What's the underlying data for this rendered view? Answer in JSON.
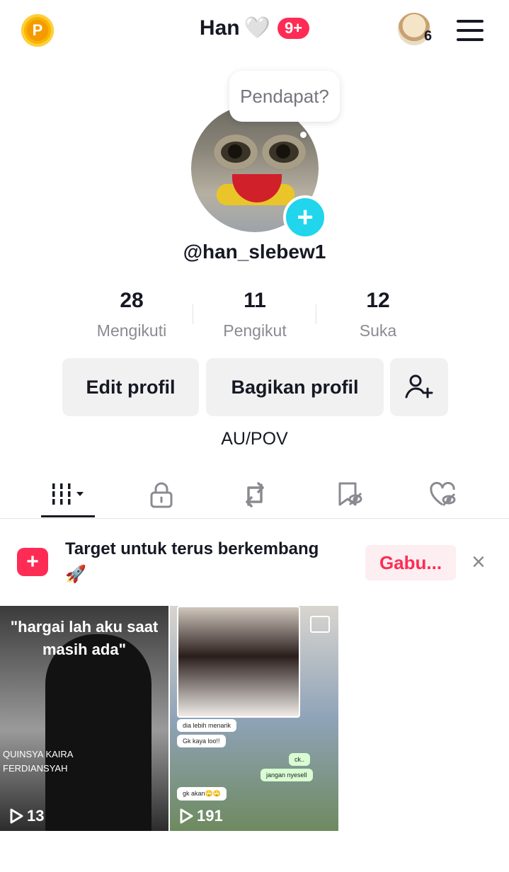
{
  "header": {
    "coin_label": "P",
    "name": "Han",
    "heart_glyph": "🤍",
    "notif_badge": "9+",
    "account_count": "6"
  },
  "profile": {
    "bubble_text": "Pendapat?",
    "username": "@han_slebew1",
    "bio": "AU/POV",
    "stats": [
      {
        "value": "28",
        "label": "Mengikuti"
      },
      {
        "value": "11",
        "label": "Pengikut"
      },
      {
        "value": "12",
        "label": "Suka"
      }
    ]
  },
  "actions": {
    "edit_label": "Edit profil",
    "share_label": "Bagikan profil"
  },
  "tabs": [
    {
      "icon": "grid-icon",
      "active": true
    },
    {
      "icon": "lock-icon"
    },
    {
      "icon": "repost-icon"
    },
    {
      "icon": "bookmark-hidden-icon"
    },
    {
      "icon": "liked-hidden-icon"
    }
  ],
  "banner": {
    "text": "Target untuk terus berkembang",
    "emoji": "🚀",
    "join_label": "Gabu...",
    "close_glyph": "×"
  },
  "videos": [
    {
      "quote": "\"hargai lah aku saat masih ada\"",
      "caption_line1": "QUINSYA KAIRA",
      "caption_line2": "FERDIANSYAH",
      "plays": "13"
    },
    {
      "plays": "191",
      "chats": [
        "dia lebih menarik",
        "Gk kaya loo!!",
        "ck..",
        "jangan nyesell",
        "gk akan🙄🙄"
      ]
    }
  ],
  "colors": {
    "accent": "#fe2c55",
    "add_button": "#20d5ec",
    "coin": "#f7b500"
  }
}
